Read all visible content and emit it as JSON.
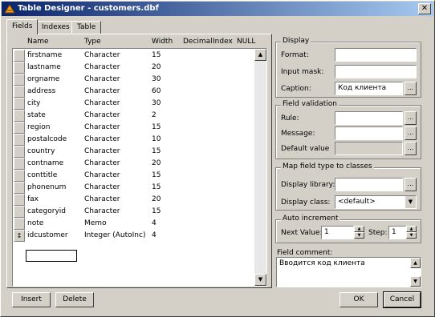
{
  "window": {
    "title": "Table Designer - customers.dbf",
    "close_glyph": "✕"
  },
  "tabs": [
    {
      "label": "Fields"
    },
    {
      "label": "Indexes"
    },
    {
      "label": "Table"
    }
  ],
  "grid": {
    "headers": [
      "Name",
      "Type",
      "Width",
      "Decimal",
      "Index",
      "NULL"
    ],
    "rows": [
      {
        "name": "firstname",
        "type": "Character",
        "width": "15"
      },
      {
        "name": "lastname",
        "type": "Character",
        "width": "20"
      },
      {
        "name": "orgname",
        "type": "Character",
        "width": "30"
      },
      {
        "name": "address",
        "type": "Character",
        "width": "60"
      },
      {
        "name": "city",
        "type": "Character",
        "width": "30"
      },
      {
        "name": "state",
        "type": "Character",
        "width": "2"
      },
      {
        "name": "region",
        "type": "Character",
        "width": "15"
      },
      {
        "name": "postalcode",
        "type": "Character",
        "width": "10"
      },
      {
        "name": "country",
        "type": "Character",
        "width": "15"
      },
      {
        "name": "contname",
        "type": "Character",
        "width": "20"
      },
      {
        "name": "conttitle",
        "type": "Character",
        "width": "15"
      },
      {
        "name": "phonenum",
        "type": "Character",
        "width": "15"
      },
      {
        "name": "fax",
        "type": "Character",
        "width": "20"
      },
      {
        "name": "categoryid",
        "type": "Character",
        "width": "15"
      },
      {
        "name": "note",
        "type": "Memo",
        "width": "4"
      },
      {
        "name": "idcustomer",
        "type": "Integer (AutoInc)",
        "width": "4",
        "current": true
      }
    ],
    "current_row_marker": "↕"
  },
  "display": {
    "title": "Display",
    "format_label": "Format:",
    "format_value": "",
    "input_mask_label": "Input mask:",
    "input_mask_value": "",
    "caption_label": "Caption:",
    "caption_value": "Код клиента"
  },
  "field_validation": {
    "title": "Field validation",
    "rule_label": "Rule:",
    "rule_value": "",
    "message_label": "Message:",
    "message_value": "",
    "default_label": "Default value"
  },
  "map_field": {
    "title": "Map field type to classes",
    "library_label": "Display library:",
    "library_value": "",
    "class_label": "Display class:",
    "class_value": "<default>"
  },
  "auto_increment": {
    "title": "Auto increment",
    "next_label": "Next Value:",
    "next_value": "1",
    "step_label": "Step:",
    "step_value": "1"
  },
  "field_comment": {
    "label": "Field comment:",
    "value": "Вводится код клиента"
  },
  "buttons": {
    "insert": "Insert",
    "delete": "Delete",
    "ok": "OK",
    "cancel": "Cancel",
    "ellipsis": "..."
  }
}
